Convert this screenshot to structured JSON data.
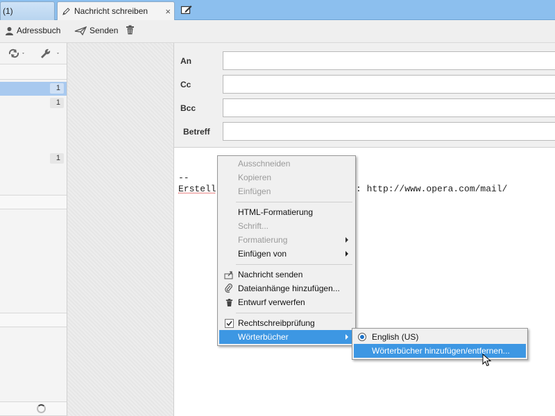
{
  "tabs": {
    "inactive_label": "(1)",
    "active_label": "Nachricht schreiben",
    "close_glyph": "×"
  },
  "toolbar": {
    "addressbook_label": "Adressbuch",
    "send_label": "Senden"
  },
  "sidebar": {
    "badges": [
      "1",
      "1",
      "1"
    ]
  },
  "headers": {
    "to_label": "An",
    "cc_label": "Cc",
    "bcc_label": "Bcc",
    "subject_label": "Betreff"
  },
  "body": {
    "sig_separator": "--",
    "sig_left": "Erstell",
    "sig_right": ": http://www.opera.com/mail/"
  },
  "context_menu": {
    "cut": "Ausschneiden",
    "copy": "Kopieren",
    "paste": "Einfügen",
    "html_format": "HTML-Formatierung",
    "font": "Schrift...",
    "formatting": "Formatierung",
    "insert_from": "Einfügen von",
    "send_message": "Nachricht senden",
    "attach": "Dateianhänge hinzufügen...",
    "discard": "Entwurf verwerfen",
    "spellcheck": "Rechtschreibprüfung",
    "dictionaries": "Wörterbücher"
  },
  "submenu": {
    "english": "English (US)",
    "manage": "Wörterbücher hinzufügen/entfernen..."
  },
  "colors": {
    "tabbar": "#8cbfee",
    "highlight": "#3d97e3",
    "sidebar_selected": "#a8c9ef"
  }
}
